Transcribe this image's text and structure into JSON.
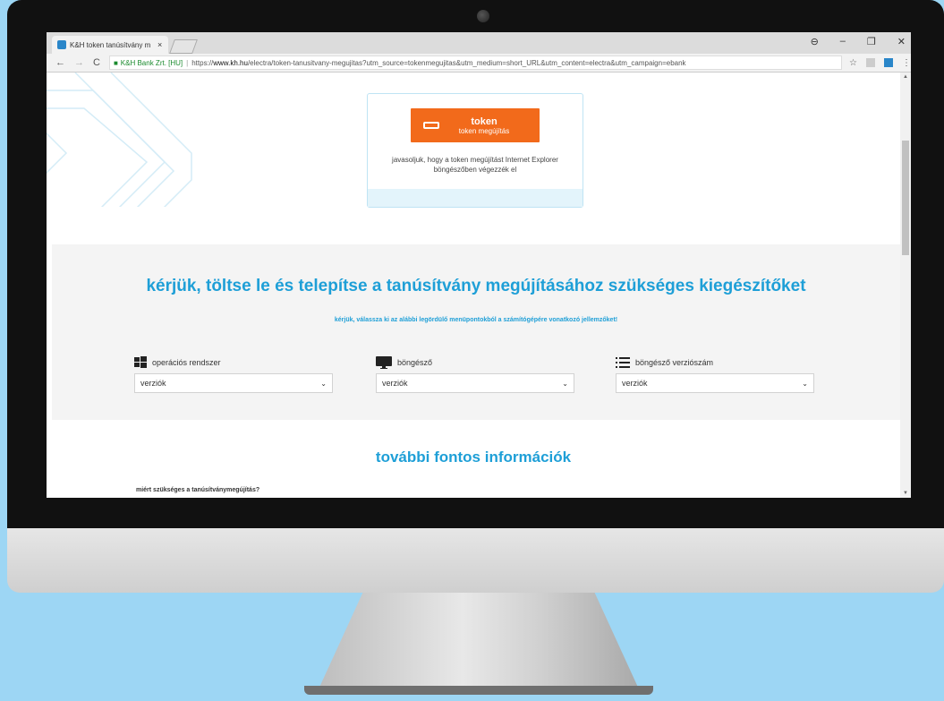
{
  "browser": {
    "tab_title": "K&H token tanúsítvány m",
    "tab_close": "×",
    "security_label": "K&H Bank Zrt. [HU]",
    "url_scheme": "https://",
    "url_host": "www.kh.hu",
    "url_path": "/electra/token-tanusitvany-megujitas?utm_source=tokenmegujitas&utm_medium=short_URL&utm_content=electra&utm_campaign=ebank",
    "nav": {
      "back": "←",
      "forward": "→",
      "reload": "C"
    },
    "window_controls": {
      "account": "⊖",
      "minimize": "–",
      "restore": "❐",
      "close": "✕"
    },
    "bookmark_star": "☆",
    "menu": "⋮"
  },
  "token_card": {
    "button_title": "token",
    "button_subtitle": "token megújítás",
    "note_line1": "javasoljuk, hogy a token megújítást Internet Explorer",
    "note_line2": "böngészőben végezzék el"
  },
  "addons": {
    "title": "kérjük, töltse le és telepítse a tanúsítvány megújításához szükséges kiegészítőket",
    "subtitle": "kérjük, válassza ki az alábbi legördülő menüpontokból a számítógépére vonatkozó jellemzőket!",
    "selectors": [
      {
        "label": "operációs rendszer",
        "icon": "windows-icon",
        "value": "verziók"
      },
      {
        "label": "böngésző",
        "icon": "monitor-icon",
        "value": "verziók"
      },
      {
        "label": "böngésző verziószám",
        "icon": "list-icon",
        "value": "verziók"
      }
    ]
  },
  "info": {
    "title": "további fontos információk",
    "question": "miért szükséges a tanúsítványmegújítás?"
  },
  "colors": {
    "accent": "#1e9fd7",
    "orange": "#f26a1b",
    "background": "#9dd6f4"
  }
}
